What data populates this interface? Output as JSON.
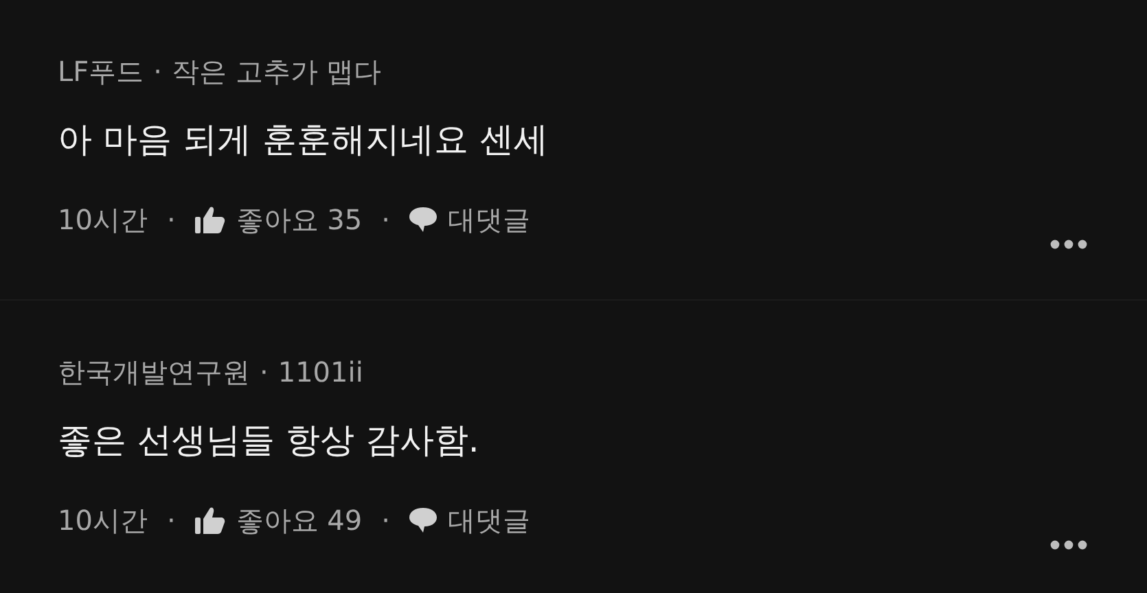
{
  "separator": "·",
  "comments": [
    {
      "author": "LF푸드",
      "handle": "작은 고추가 맵다",
      "text": "아 마음 되게 훈훈해지네요 센세",
      "time": "10시간",
      "likes": "좋아요 35",
      "reply": "대댓글"
    },
    {
      "author": "한국개발연구원",
      "handle": "1101ii",
      "text": "좋은 선생님들 항상 감사함.",
      "time": "10시간",
      "likes": "좋아요 49",
      "reply": "대댓글"
    }
  ]
}
